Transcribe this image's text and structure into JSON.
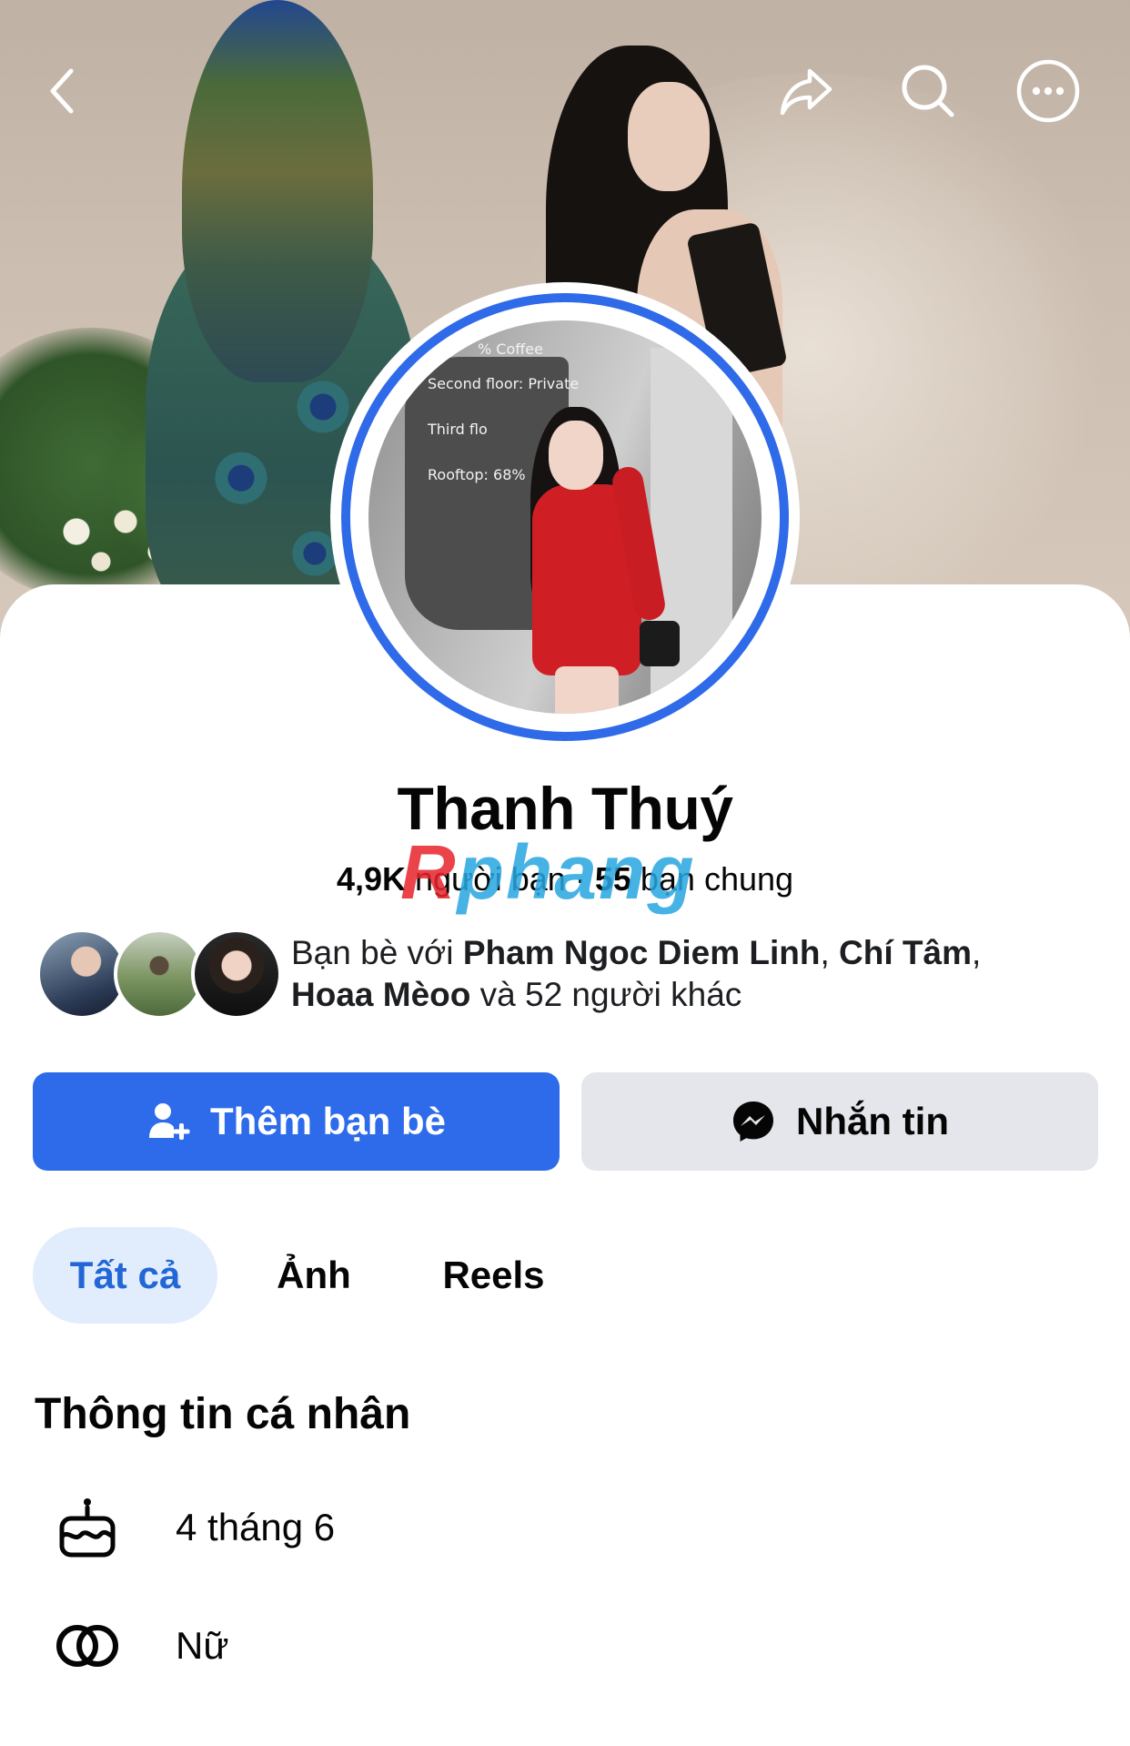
{
  "profile": {
    "name": "Thanh Thuý",
    "friend_count": "4,9K",
    "friend_word": " người bạn · ",
    "mutual_count": "55",
    "mutual_word": " bạn chung"
  },
  "watermark": {
    "first": "R",
    "rest": "phang"
  },
  "cover_photo_alt": "",
  "avatar_sign": {
    "line1": "% Coffee",
    "line2": "Second floor: Private",
    "line3": "Third flo",
    "line4": "Rooftop: 68%"
  },
  "mutual": {
    "prefix": "Bạn bè với ",
    "friend1": "Pham Ngoc Diem Linh",
    "sep1": ", ",
    "friend2": "Chí Tâm",
    "sep2": ",",
    "friend3": "Hoaa Mèoo",
    "suffix": " và 52 người khác"
  },
  "actions": {
    "add_friend": "Thêm bạn bè",
    "message": "Nhắn tin"
  },
  "tabs": [
    {
      "label": "Tất cả",
      "active": true
    },
    {
      "label": "Ảnh",
      "active": false
    },
    {
      "label": "Reels",
      "active": false
    }
  ],
  "personal_info": {
    "title": "Thông tin cá nhân",
    "birthday": "4 tháng 6",
    "gender": "Nữ"
  },
  "icons": {
    "back": "chevron-left-icon",
    "share": "share-arrow-icon",
    "search": "search-icon",
    "more": "more-dots-icon",
    "add_friend": "person-add-icon",
    "messenger": "messenger-icon",
    "birthday": "cake-icon",
    "gender": "gender-rings-icon"
  },
  "colors": {
    "primary": "#2d6bea",
    "secondary_button": "#e4e6eb",
    "active_tab_bg": "#e1edfd",
    "active_tab_text": "#2366d6",
    "avatar_ring": "#2f6be8"
  }
}
